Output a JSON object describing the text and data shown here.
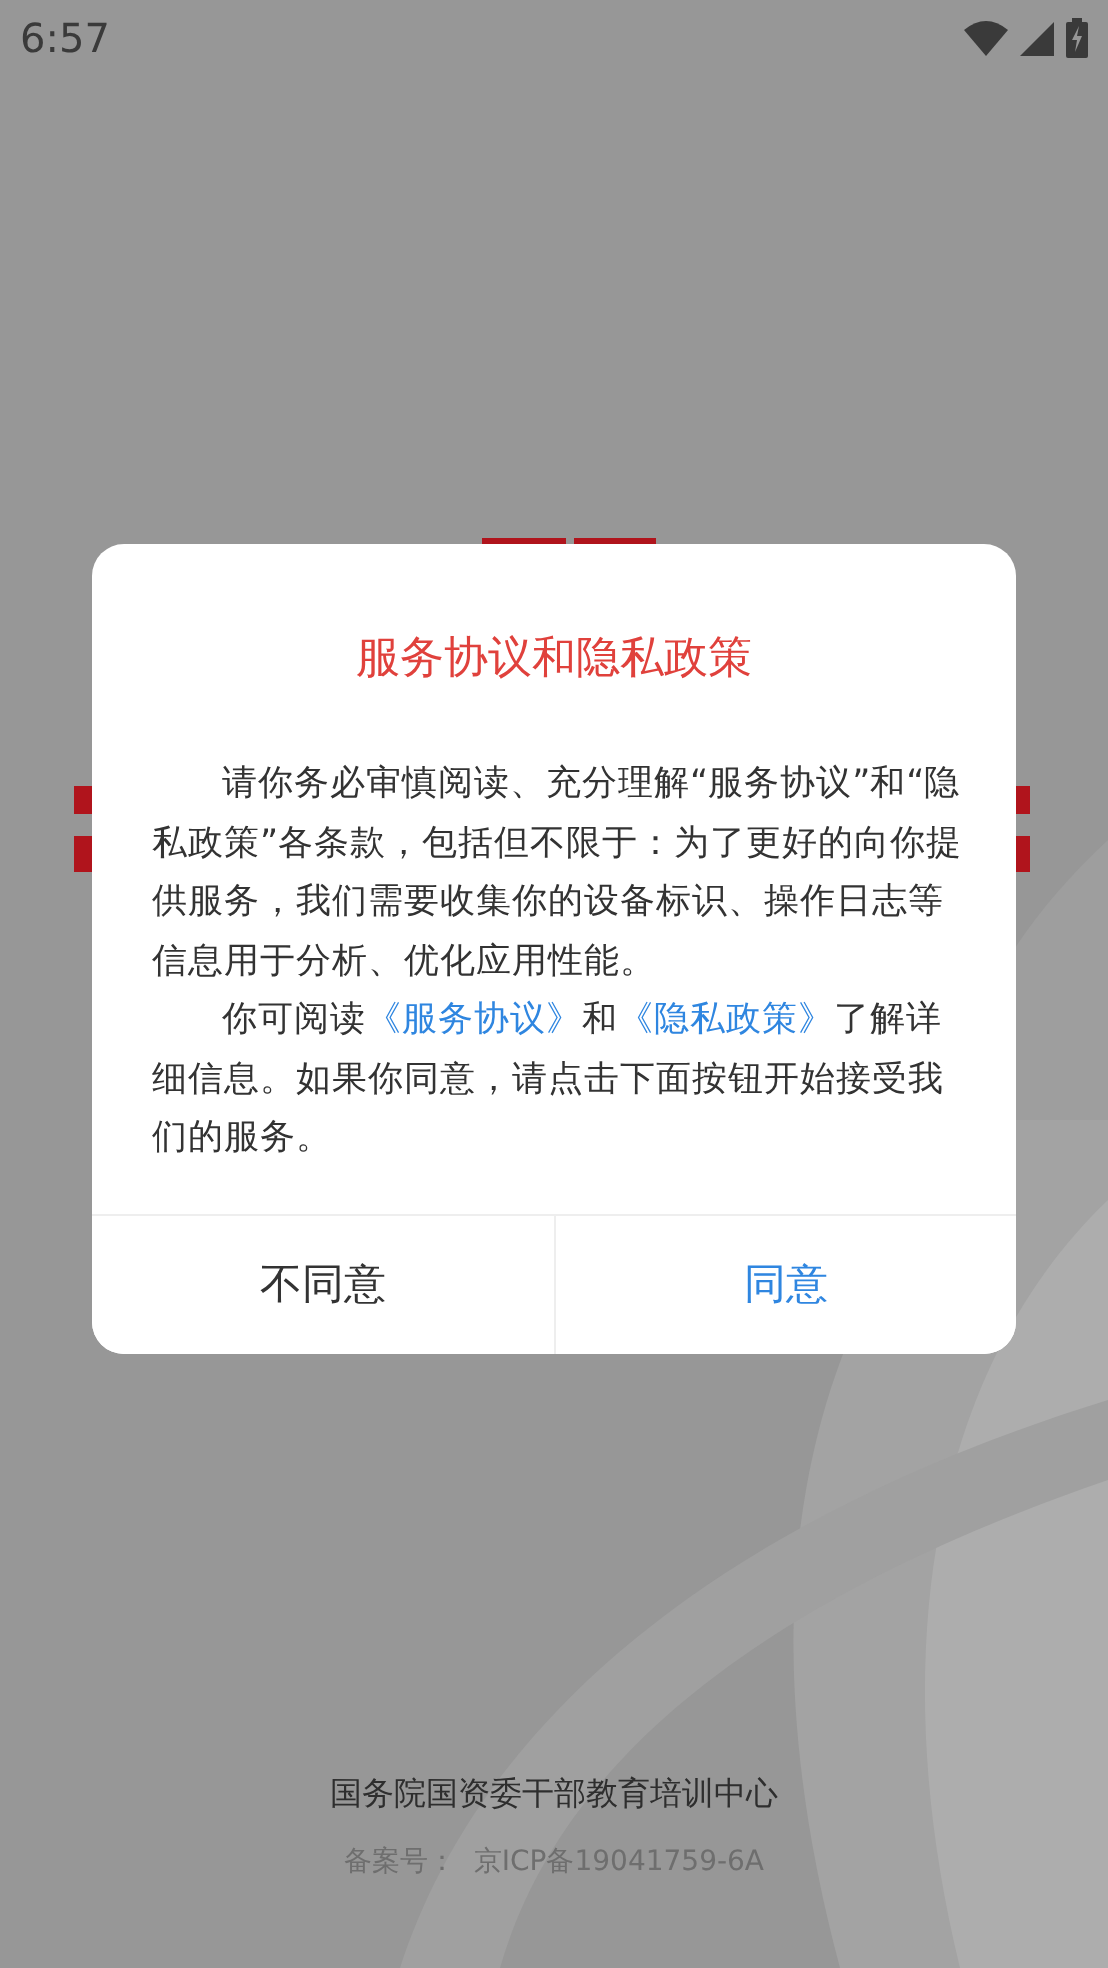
{
  "status_bar": {
    "time": "6:57"
  },
  "dialog": {
    "title": "服务协议和隐私政策",
    "paragraphs": [
      {
        "parts": [
          {
            "kind": "text",
            "text": "请你务必审慎阅读、充分理解“服务协议”和“隐私政策”各条款，包括但不限于：为了更好的向你提供服务，我们需要收集你的设备标识、操作日志等信息用于分析、优化应用性能。"
          }
        ]
      },
      {
        "parts": [
          {
            "kind": "text",
            "text": "你可阅读"
          },
          {
            "kind": "link",
            "text": "《服务协议》"
          },
          {
            "kind": "text",
            "text": "和"
          },
          {
            "kind": "link",
            "text": "《隐私政策》"
          },
          {
            "kind": "text",
            "text": "了解详细信息。如果你同意，请点击下面按钮开始接受我们的服务。"
          }
        ]
      }
    ],
    "buttons": [
      {
        "label": "不同意",
        "kind": "decline"
      },
      {
        "label": "同意",
        "kind": "accept"
      }
    ]
  },
  "footer": {
    "organization": "国务院国资委干部教育培训中心",
    "record": "备案号：  京ICP备19041759-6A"
  }
}
